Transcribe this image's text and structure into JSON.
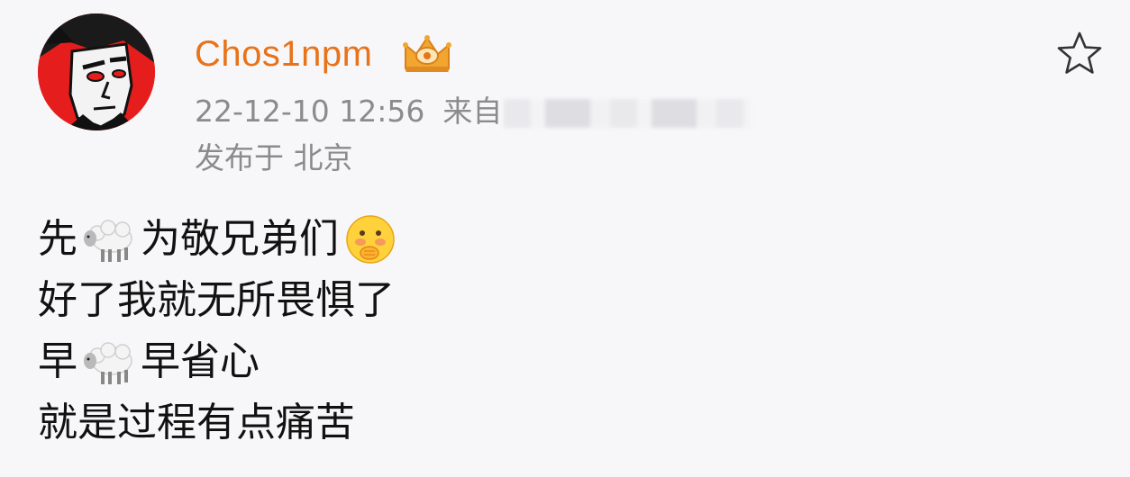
{
  "post": {
    "author": {
      "name": "Chos1npm",
      "badge_icon": "crown-badge-icon",
      "avatar_icon": "cartoon-avatar"
    },
    "meta": {
      "timestamp": "22-12-10 12:56",
      "source_prefix": "来自",
      "location": "发布于 北京"
    },
    "actions": {
      "favorite_icon": "star-outline-icon"
    },
    "content": {
      "line1_a": "先",
      "line1_b": "为敬兄弟们",
      "line2": "好了我就无所畏惧了",
      "line3_a": "早",
      "line3_b": "早省心",
      "line4": "就是过程有点痛苦",
      "emoji_sheep": "sheep-emoji",
      "emoji_face": "shy-face-emoji"
    }
  },
  "colors": {
    "background": "#f7f7f9",
    "username": "#e8731a",
    "meta_text": "#8b8b8b",
    "body_text": "#111111"
  }
}
